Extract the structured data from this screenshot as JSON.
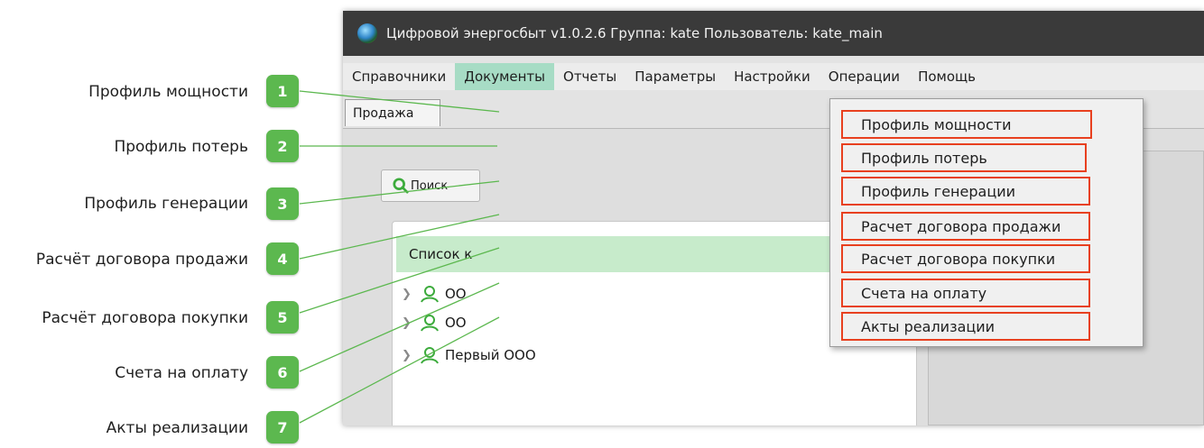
{
  "window": {
    "title": "Цифровой энергосбыт v1.0.2.6 Группа: kate Пользователь: kate_main"
  },
  "menu": [
    {
      "label": "Справочники"
    },
    {
      "label": "Документы"
    },
    {
      "label": "Отчеты"
    },
    {
      "label": "Параметры"
    },
    {
      "label": "Настройки"
    },
    {
      "label": "Операции"
    },
    {
      "label": "Помощь"
    }
  ],
  "tab": {
    "label": "Продажа"
  },
  "search_button": {
    "label": "Поиск"
  },
  "list": {
    "header": "Список к",
    "items": [
      {
        "label": "ОО"
      },
      {
        "label": "ОО"
      },
      {
        "label": "Первый ООО"
      }
    ]
  },
  "dropdown": [
    {
      "label": "Профиль мощности"
    },
    {
      "label": "Профиль потерь"
    },
    {
      "label": "Профиль генерации"
    },
    {
      "label": "Расчет договора продажи"
    },
    {
      "label": "Расчет договора покупки"
    },
    {
      "label": "Счета на оплату"
    },
    {
      "label": "Акты реализации"
    }
  ],
  "callouts": [
    {
      "number": "1",
      "label": "Профиль мощности"
    },
    {
      "number": "2",
      "label": "Профиль потерь"
    },
    {
      "number": "3",
      "label": "Профиль генерации"
    },
    {
      "number": "4",
      "label": "Расчёт договора продажи"
    },
    {
      "number": "5",
      "label": "Расчёт договора покупки"
    },
    {
      "number": "6",
      "label": "Счета на оплату"
    },
    {
      "number": "7",
      "label": "Акты реализации"
    }
  ],
  "colors": {
    "badge": "#5cb84f",
    "highlight_border": "#e8401f",
    "active_menu": "#a7dcc5",
    "list_header": "#c7ebcb"
  }
}
